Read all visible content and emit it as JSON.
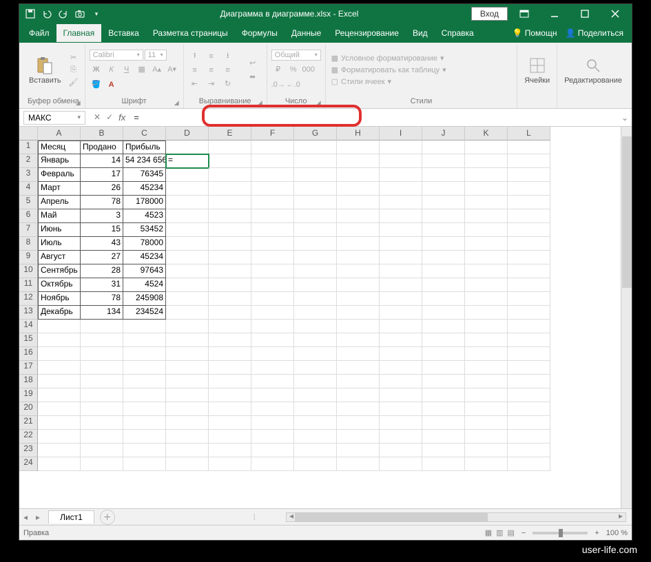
{
  "title": "Диаграмма в диаграмме.xlsx  -  Excel",
  "login_btn": "Вход",
  "tabs": {
    "file": "Файл",
    "home": "Главная",
    "insert": "Вставка",
    "layout": "Разметка страницы",
    "formulas": "Формулы",
    "data": "Данные",
    "review": "Рецензирование",
    "view": "Вид",
    "help": "Справка",
    "tellme": "Помощн",
    "share": "Поделиться"
  },
  "ribbon": {
    "paste": "Вставить",
    "clipboard": "Буфер обмена",
    "font_name": "Calibri",
    "font_size": "11",
    "font": "Шрифт",
    "alignment": "Выравнивание",
    "number_format": "Общий",
    "number": "Число",
    "cond_fmt": "Условное форматирование",
    "fmt_table": "Форматировать как таблицу",
    "cell_styles": "Стили ячеек",
    "styles": "Стили",
    "cells": "Ячейки",
    "editing": "Редактирование",
    "btns": {
      "b": "Ж",
      "i": "К",
      "u": "Ч"
    }
  },
  "formula_bar": {
    "namebox": "МАКС",
    "formula": "="
  },
  "columns": [
    "A",
    "B",
    "C",
    "D",
    "E",
    "F",
    "G",
    "H",
    "I",
    "J",
    "K",
    "L"
  ],
  "rows": [
    1,
    2,
    3,
    4,
    5,
    6,
    7,
    8,
    9,
    10,
    11,
    12,
    13,
    14,
    15,
    16,
    17,
    18,
    19,
    20,
    21,
    22,
    23,
    24
  ],
  "data": {
    "headers": [
      "Месяц",
      "Продано",
      "Прибыль"
    ],
    "months": [
      "Январь",
      "Февраль",
      "Март",
      "Апрель",
      "Май",
      "Июнь",
      "Июль",
      "Август",
      "Сентябрь",
      "Октябрь",
      "Ноябрь",
      "Декабрь"
    ],
    "sold": [
      "14",
      "17",
      "26",
      "78",
      "3",
      "15",
      "43",
      "27",
      "28",
      "31",
      "78",
      "134"
    ],
    "profit": [
      "54 234 656",
      "76345",
      "45234",
      "178000",
      "4523",
      "53452",
      "78000",
      "45234",
      "97643",
      "4524",
      "245908",
      "234524"
    ],
    "d2": "="
  },
  "sheet_tab": "Лист1",
  "status": "Правка",
  "zoom": "100 %",
  "watermark": "user-life.com"
}
